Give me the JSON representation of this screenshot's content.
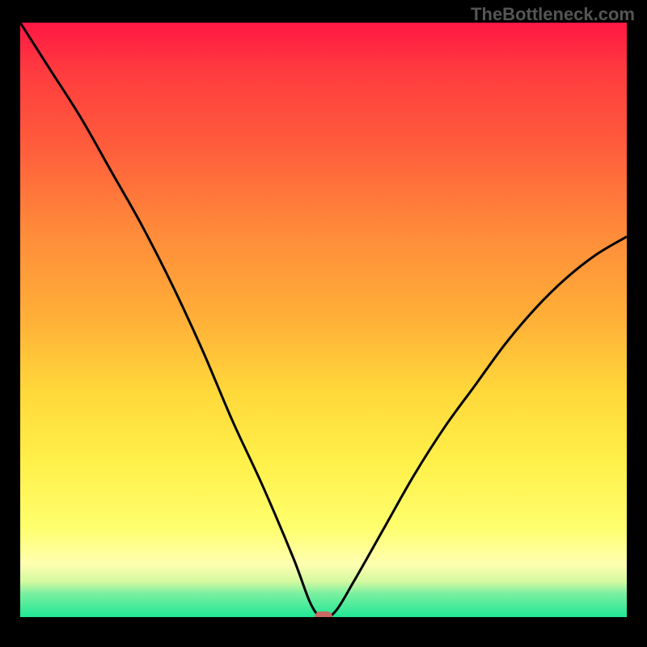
{
  "watermark": "TheBottleneck.com",
  "colors": {
    "background": "#000000",
    "curve": "#000000",
    "marker": "#c96b63",
    "gradient_top": "#ff1744",
    "gradient_bottom": "#1fe796"
  },
  "chart_data": {
    "type": "line",
    "title": "",
    "xlabel": "",
    "ylabel": "",
    "xlim": [
      0,
      100
    ],
    "ylim": [
      0,
      100
    ],
    "grid": false,
    "legend": "none",
    "series": [
      {
        "name": "bottleneck-curve",
        "x": [
          0,
          5,
          10,
          15,
          20,
          25,
          30,
          35,
          40,
          45,
          48,
          50,
          52,
          55,
          60,
          65,
          70,
          75,
          80,
          85,
          90,
          95,
          100
        ],
        "y": [
          100,
          92,
          84,
          75,
          66,
          56,
          45,
          33,
          22,
          10,
          2,
          0,
          1,
          6,
          15,
          24,
          32,
          39,
          46,
          52,
          57,
          61,
          64
        ]
      }
    ],
    "annotations": [
      {
        "name": "optimal-point",
        "x": 50,
        "y": 0
      }
    ]
  }
}
